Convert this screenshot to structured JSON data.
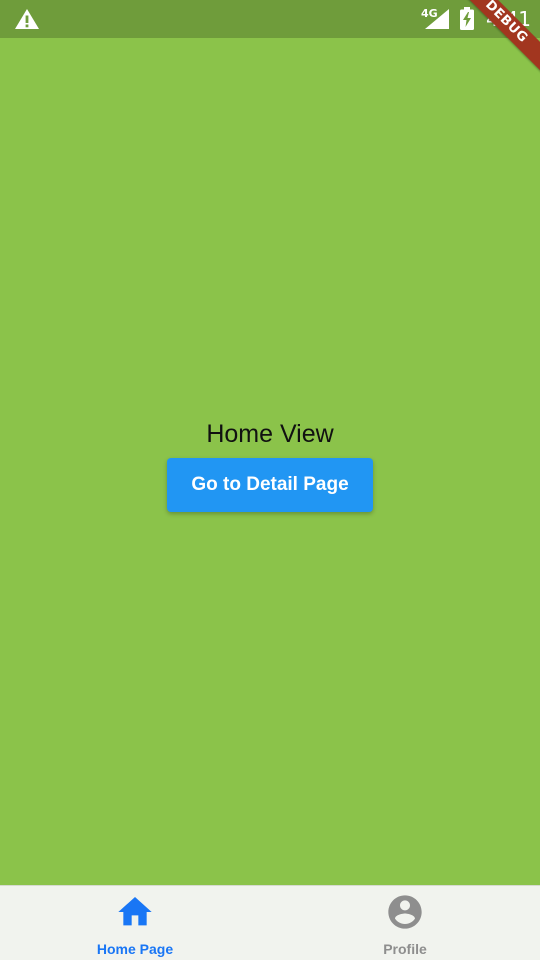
{
  "status_bar": {
    "warning_icon": "warning-icon",
    "network_label": "4G",
    "signal_icon": "cell-signal-icon",
    "battery_icon": "battery-charging-icon",
    "time": "4:41",
    "background": "#6f9c3b"
  },
  "debug_banner": {
    "label": "DEBUG",
    "color": "#a2361f"
  },
  "main": {
    "background": "#8bc34a",
    "title": "Home View",
    "button_label": "Go to Detail Page",
    "button_color": "#2196f3"
  },
  "bottom_nav": {
    "background": "#f1f3ee",
    "items": [
      {
        "label": "Home Page",
        "icon": "home-icon",
        "active": true,
        "color": "#1976f5"
      },
      {
        "label": "Profile",
        "icon": "account-circle-icon",
        "active": false,
        "color": "#8e8e8e"
      }
    ]
  }
}
